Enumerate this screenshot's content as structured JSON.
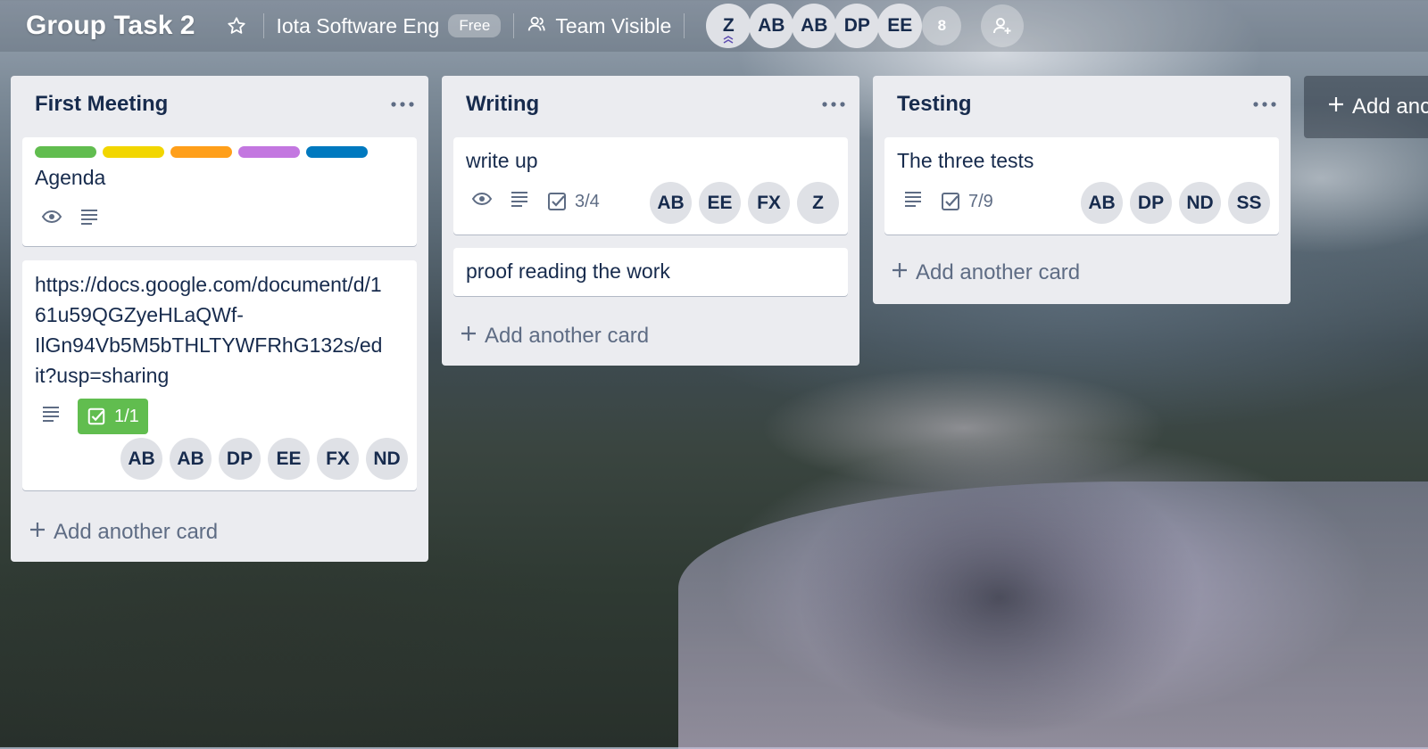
{
  "header": {
    "board_title": "Group Task 2",
    "team_name": "Iota Software Eng",
    "plan_badge": "Free",
    "visibility": "Team Visible",
    "members": [
      "Z",
      "AB",
      "AB",
      "DP",
      "EE"
    ],
    "member_overflow": "8"
  },
  "lists": [
    {
      "title": "First Meeting",
      "cards": [
        {
          "labels": [
            "#61bd4f",
            "#f2d600",
            "#ff9f1a",
            "#c377e0",
            "#0079bf"
          ],
          "title": "Agenda"
        },
        {
          "title": "https://docs.google.com/document/d/161u59QGZyeHLaQWf-IlGn94Vb5M5bTHLTYWFRhG132s/edit?usp=sharing",
          "title_lines": [
            "https://docs.google.com/document/d/1",
            "61u59QGZyeHLaQWf-",
            "IlGn94Vb5M5bTHLTYWFRhG132s/ed",
            "it?usp=sharing"
          ],
          "checklist": "1/1",
          "members": [
            "AB",
            "AB",
            "DP",
            "EE",
            "FX",
            "ND"
          ]
        }
      ],
      "add_card": "Add another card"
    },
    {
      "title": "Writing",
      "cards": [
        {
          "title": "write up",
          "checklist": "3/4",
          "members": [
            "AB",
            "EE",
            "FX",
            "Z"
          ]
        },
        {
          "title": "proof reading the work"
        }
      ],
      "add_card": "Add another card"
    },
    {
      "title": "Testing",
      "cards": [
        {
          "title": "The three tests",
          "checklist": "7/9",
          "members": [
            "AB",
            "DP",
            "ND",
            "SS"
          ]
        }
      ],
      "add_card": "Add another card"
    }
  ],
  "add_list": "Add anc",
  "icons": {
    "star": "star-icon",
    "team": "team-icon",
    "invite": "invite-member-icon",
    "watch": "eye-icon",
    "description": "description-icon",
    "checklist": "checklist-icon",
    "menu": "more-icon",
    "add": "plus-icon"
  }
}
